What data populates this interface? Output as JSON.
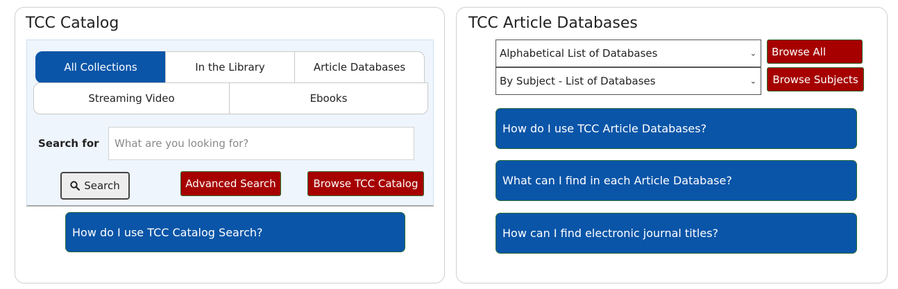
{
  "catalog": {
    "title": "TCC Catalog",
    "tabs": [
      "All Collections",
      "In the Library",
      "Article Databases",
      "Streaming Video",
      "Ebooks"
    ],
    "search_label": "Search for",
    "search_placeholder": "What are you looking for?",
    "search_button": "Search",
    "advanced_search": "Advanced Search",
    "browse_catalog": "Browse TCC Catalog",
    "help_link": "How do I use TCC Catalog Search?"
  },
  "databases": {
    "title": "TCC Article Databases",
    "select_alpha": "Alphabetical List of Databases",
    "select_subject": "By Subject - List of Databases",
    "browse_all": "Browse All",
    "browse_subjects": "Browse Subjects",
    "help_links": [
      "How do I use TCC Article Databases?",
      "What can I find in each Article Database?",
      "How can I find electronic journal titles?"
    ]
  },
  "colors": {
    "primary_blue": "#0a55a8",
    "action_red": "#a60000"
  }
}
